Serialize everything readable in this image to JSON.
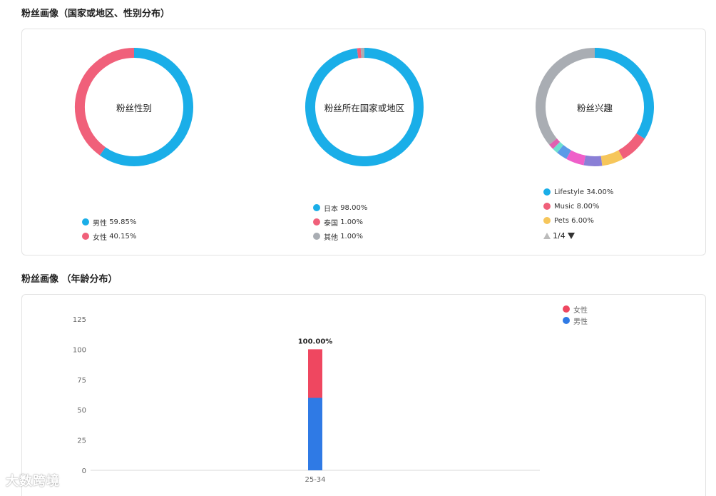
{
  "section1_title": "粉丝画像（国家或地区、性别分布）",
  "section2_title": "粉丝画像 （年龄分布）",
  "gender_chart": {
    "center_label": "粉丝性别",
    "slices": [
      {
        "label": "男性",
        "pct": "59.85%",
        "value": 59.85,
        "color": "#1aaee8"
      },
      {
        "label": "女性",
        "pct": "40.15%",
        "value": 40.15,
        "color": "#f0607a"
      }
    ]
  },
  "country_chart": {
    "center_label": "粉丝所在国家或地区",
    "slices": [
      {
        "label": "日本",
        "pct": "98.00%",
        "value": 98,
        "color": "#1aaee8"
      },
      {
        "label": "泰国",
        "pct": "1.00%",
        "value": 1,
        "color": "#f0607a"
      },
      {
        "label": "其他",
        "pct": "1.00%",
        "value": 1,
        "color": "#a9adb3"
      }
    ]
  },
  "interest_chart": {
    "center_label": "粉丝兴趣",
    "slices": [
      {
        "value": 34,
        "color": "#1aaee8"
      },
      {
        "value": 8,
        "color": "#f0607a"
      },
      {
        "value": 6,
        "color": "#f6c65b"
      },
      {
        "value": 5,
        "color": "#8a7fd6"
      },
      {
        "value": 5,
        "color": "#ef5fc9"
      },
      {
        "value": 3,
        "color": "#5b9be8"
      },
      {
        "value": 1.5,
        "color": "#6ee0d0"
      },
      {
        "value": 1.5,
        "color": "#e060b0"
      },
      {
        "value": 36,
        "color": "#a9adb3"
      }
    ],
    "legend": [
      {
        "label": "Lifestyle",
        "pct": "34.00%",
        "color": "#1aaee8"
      },
      {
        "label": "Music",
        "pct": "8.00%",
        "color": "#f0607a"
      },
      {
        "label": "Pets",
        "pct": "6.00%",
        "color": "#f6c65b"
      }
    ],
    "pager": "1/4"
  },
  "chart_data": {
    "type": "bar",
    "categories": [
      "25-34"
    ],
    "series": [
      {
        "name": "男性",
        "values": [
          59.85
        ],
        "color": "#2f7ae5"
      },
      {
        "name": "女性",
        "values": [
          40.15
        ],
        "color": "#ef4760"
      }
    ],
    "stacked": true,
    "total_labels": [
      "100.00%"
    ],
    "ylim": [
      0,
      125
    ],
    "yticks": [
      0,
      25,
      50,
      75,
      100,
      125
    ],
    "legend_placement": "top-right",
    "legend_order": [
      "女性",
      "男性"
    ]
  },
  "watermark": "大数跨境"
}
